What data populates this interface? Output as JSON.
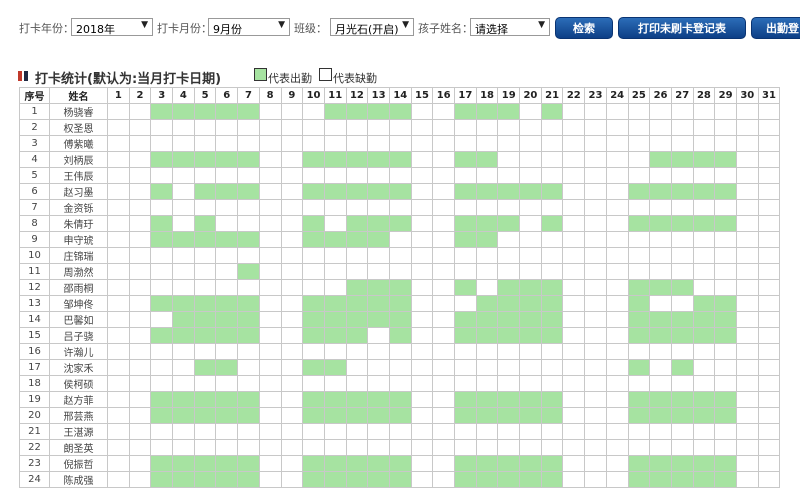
{
  "toolbar": {
    "year_label": "打卡年份：",
    "year_value": "2018年",
    "month_label": "打卡月份：",
    "month_value": "9月份",
    "class_label": "班级：",
    "class_value": "月光石(开启)",
    "child_label": "孩子姓名：",
    "child_value": "请选择",
    "search_label": "检索",
    "print_label": "打印未刷卡登记表",
    "attendance_label": "出勤登"
  },
  "section": {
    "title": "打卡统计(默认为:当月打卡日期)",
    "legend_present": "代表出勤",
    "legend_absent": "代表缺勤",
    "present_color": "#a6e3a1"
  },
  "table": {
    "header_index": "序号",
    "header_name": "姓名",
    "days": [
      "1",
      "2",
      "3",
      "4",
      "5",
      "6",
      "7",
      "8",
      "9",
      "10",
      "11",
      "12",
      "13",
      "14",
      "15",
      "16",
      "17",
      "18",
      "19",
      "20",
      "21",
      "22",
      "23",
      "24",
      "25",
      "26",
      "27",
      "28",
      "29",
      "30",
      "31"
    ],
    "rows": [
      {
        "no": "1",
        "name": "杨骁睿",
        "present": [
          3,
          4,
          5,
          6,
          7,
          11,
          12,
          13,
          14,
          17,
          18,
          19,
          21
        ]
      },
      {
        "no": "2",
        "name": "权圣恩",
        "present": []
      },
      {
        "no": "3",
        "name": "傅紫曦",
        "present": []
      },
      {
        "no": "4",
        "name": "刘柄辰",
        "present": [
          3,
          4,
          5,
          6,
          7,
          10,
          11,
          12,
          13,
          14,
          17,
          18,
          26,
          27,
          28,
          29
        ]
      },
      {
        "no": "5",
        "name": "王伟辰",
        "present": []
      },
      {
        "no": "6",
        "name": "赵习墨",
        "present": [
          3,
          5,
          6,
          7,
          10,
          11,
          12,
          13,
          14,
          17,
          18,
          19,
          20,
          21,
          25,
          26,
          27,
          28,
          29
        ]
      },
      {
        "no": "7",
        "name": "金资铄",
        "present": []
      },
      {
        "no": "8",
        "name": "朱倩玗",
        "present": [
          3,
          5,
          10,
          12,
          13,
          14,
          17,
          18,
          19,
          21,
          25,
          26,
          27,
          28,
          29
        ]
      },
      {
        "no": "9",
        "name": "申守琥",
        "present": [
          3,
          4,
          5,
          6,
          7,
          10,
          11,
          12,
          13,
          17,
          18
        ]
      },
      {
        "no": "10",
        "name": "庄锦瑞",
        "present": []
      },
      {
        "no": "11",
        "name": "周渤然",
        "present": [
          7
        ]
      },
      {
        "no": "12",
        "name": "邵雨桐",
        "present": [
          12,
          13,
          14,
          17,
          19,
          20,
          21,
          25,
          26,
          27
        ]
      },
      {
        "no": "13",
        "name": "邹坤佟",
        "present": [
          3,
          4,
          5,
          6,
          7,
          10,
          11,
          12,
          13,
          14,
          18,
          19,
          20,
          21,
          25,
          28,
          29
        ]
      },
      {
        "no": "14",
        "name": "巴馨如",
        "present": [
          4,
          5,
          6,
          7,
          10,
          11,
          12,
          13,
          14,
          17,
          18,
          19,
          20,
          21,
          25,
          26,
          27,
          28,
          29
        ]
      },
      {
        "no": "15",
        "name": "吕子骁",
        "present": [
          3,
          4,
          5,
          6,
          7,
          10,
          11,
          12,
          14,
          17,
          18,
          19,
          20,
          21,
          25,
          26,
          27,
          28,
          29
        ]
      },
      {
        "no": "16",
        "name": "许瀚儿",
        "present": []
      },
      {
        "no": "17",
        "name": "沈家禾",
        "present": [
          5,
          6,
          10,
          11,
          25,
          27
        ]
      },
      {
        "no": "18",
        "name": "侯柯硕",
        "present": []
      },
      {
        "no": "19",
        "name": "赵方菲",
        "present": [
          3,
          4,
          5,
          6,
          7,
          10,
          11,
          12,
          13,
          14,
          17,
          18,
          19,
          20,
          21,
          25,
          26,
          27,
          28,
          29
        ]
      },
      {
        "no": "20",
        "name": "邢芸燕",
        "present": [
          3,
          4,
          5,
          6,
          7,
          10,
          11,
          12,
          13,
          14,
          17,
          18,
          19,
          20,
          21,
          25,
          26,
          27,
          28,
          29
        ]
      },
      {
        "no": "21",
        "name": "王湛源",
        "present": []
      },
      {
        "no": "22",
        "name": "朗圣英",
        "present": []
      },
      {
        "no": "23",
        "name": "倪振哲",
        "present": [
          3,
          4,
          5,
          6,
          7,
          10,
          11,
          12,
          13,
          14,
          17,
          18,
          19,
          20,
          21,
          25,
          26,
          27,
          28,
          29
        ]
      },
      {
        "no": "24",
        "name": "陈成强",
        "present": [
          3,
          4,
          5,
          6,
          7,
          10,
          11,
          12,
          13,
          14,
          17,
          18,
          19,
          20,
          21,
          25,
          26,
          27,
          28,
          29
        ]
      }
    ]
  }
}
